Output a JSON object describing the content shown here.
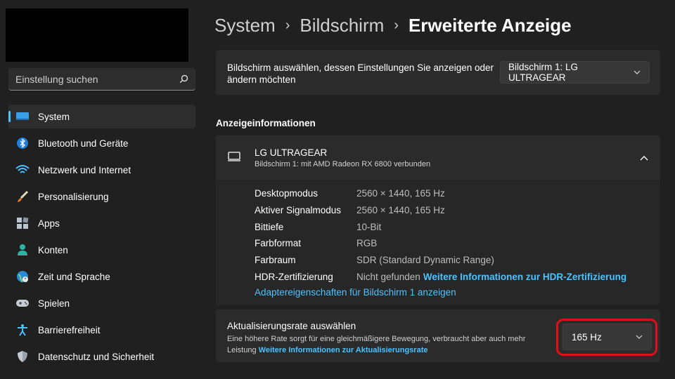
{
  "search": {
    "placeholder": "Einstellung suchen",
    "icon": "search-icon"
  },
  "sidebar": {
    "items": [
      {
        "label": "System",
        "icon": "monitor-icon",
        "active": true
      },
      {
        "label": "Bluetooth und Geräte",
        "icon": "bluetooth-icon"
      },
      {
        "label": "Netzwerk und Internet",
        "icon": "wifi-icon"
      },
      {
        "label": "Personalisierung",
        "icon": "brush-icon"
      },
      {
        "label": "Apps",
        "icon": "apps-icon"
      },
      {
        "label": "Konten",
        "icon": "person-icon"
      },
      {
        "label": "Zeit und Sprache",
        "icon": "globe-clock-icon"
      },
      {
        "label": "Spielen",
        "icon": "gamepad-icon"
      },
      {
        "label": "Barrierefreiheit",
        "icon": "accessibility-icon"
      },
      {
        "label": "Datenschutz und Sicherheit",
        "icon": "shield-icon"
      }
    ]
  },
  "breadcrumb": {
    "items": [
      "System",
      "Bildschirm",
      "Erweiterte Anzeige"
    ]
  },
  "select_display": {
    "text": "Bildschirm auswählen, dessen Einstellungen Sie anzeigen oder ändern möchten",
    "selected": "Bildschirm 1: LG ULTRAGEAR"
  },
  "section_title": "Anzeigeinformationen",
  "display": {
    "name": "LG ULTRAGEAR",
    "subtitle": "Bildschirm 1: mit AMD Radeon RX 6800 verbunden",
    "rows": [
      {
        "label": "Desktopmodus",
        "value": "2560 × 1440, 165 Hz"
      },
      {
        "label": "Aktiver Signalmodus",
        "value": "2560 × 1440, 165 Hz"
      },
      {
        "label": "Bittiefe",
        "value": "10-Bit"
      },
      {
        "label": "Farbformat",
        "value": "RGB"
      },
      {
        "label": "Farbraum",
        "value": "SDR (Standard Dynamic Range)"
      },
      {
        "label": "HDR-Zertifizierung",
        "value": "Nicht gefunden",
        "link": "Weitere Informationen zur HDR-Zertifizierung"
      }
    ],
    "adapter_link": "Adaptereigenschaften für Bildschirm 1 anzeigen"
  },
  "refresh": {
    "title": "Aktualisierungsrate auswählen",
    "description": "Eine höhere Rate sorgt für eine gleichmäßigere Bewegung, verbraucht aber auch mehr Leistung",
    "link": "Weitere Informationen zur Aktualisierungsrate",
    "selected": "165 Hz"
  },
  "colors": {
    "accent": "#4cc2ff",
    "highlight": "#e0101a",
    "background": "#202020",
    "card": "#2b2b2b"
  }
}
